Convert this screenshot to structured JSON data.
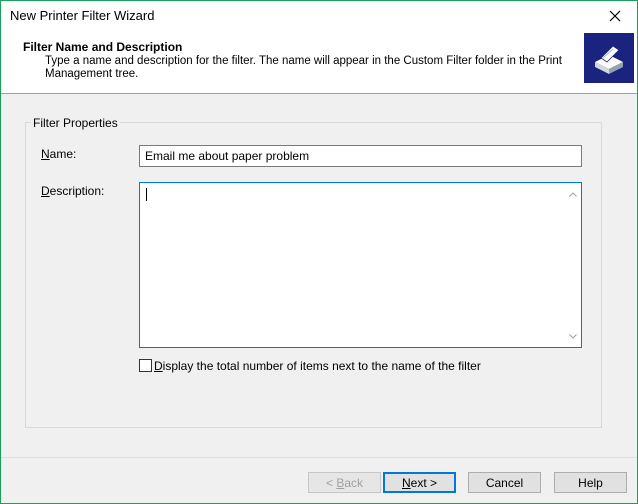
{
  "window": {
    "title": "New Printer Filter Wizard",
    "close_glyph": "✕"
  },
  "header": {
    "title": "Filter Name and Description",
    "description": "Type a name and description for the filter. The name will appear in the Custom Filter folder in the Print Management tree.",
    "icon": "printer-icon"
  },
  "group": {
    "legend": "Filter Properties"
  },
  "fields": {
    "name_label_mnemonic": "N",
    "name_label_rest": "ame:",
    "name_value": "Email me about paper problem",
    "description_label_mnemonic": "D",
    "description_label_rest": "escription:",
    "description_value": ""
  },
  "checkbox": {
    "label_mnemonic": "D",
    "label_rest": "isplay the total number of items next to the name of the filter",
    "checked": false
  },
  "buttons": {
    "back_prefix": "< ",
    "back_mnemonic": "B",
    "back_rest": "ack",
    "next_mnemonic": "N",
    "next_rest": "ext >",
    "cancel": "Cancel",
    "help": "Help"
  },
  "colors": {
    "accent": "#0078d7",
    "header_icon_bg": "#1a237e",
    "window_border": "#1aa05a"
  }
}
